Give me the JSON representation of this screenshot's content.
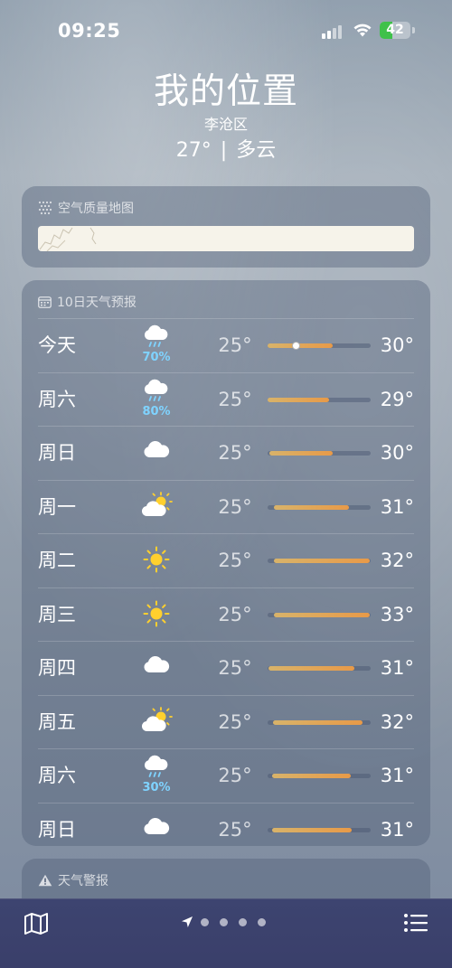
{
  "status": {
    "time": "09:25",
    "battery": "42",
    "battery_level": 42
  },
  "header": {
    "city": "我的位置",
    "district": "李沧区",
    "temp": "27°",
    "separator": "|",
    "condition": "多云"
  },
  "air_quality": {
    "title": "空气质量地图"
  },
  "forecast": {
    "title": "10日天气预报",
    "days": [
      {
        "day": "今天",
        "icon": "rain-icon",
        "pct": "70%",
        "lo": "25°",
        "hi": "30°",
        "bar_start": 0.0,
        "bar_end": 0.63,
        "current": 0.27
      },
      {
        "day": "周六",
        "icon": "rain-icon",
        "pct": "80%",
        "lo": "25°",
        "hi": "29°",
        "bar_start": 0.0,
        "bar_end": 0.6
      },
      {
        "day": "周日",
        "icon": "cloud-icon",
        "pct": "",
        "lo": "25°",
        "hi": "30°",
        "bar_start": 0.02,
        "bar_end": 0.63
      },
      {
        "day": "周一",
        "icon": "sun-cloud-icon",
        "pct": "",
        "lo": "25°",
        "hi": "31°",
        "bar_start": 0.06,
        "bar_end": 0.79
      },
      {
        "day": "周二",
        "icon": "sun-icon",
        "pct": "",
        "lo": "25°",
        "hi": "32°",
        "bar_start": 0.06,
        "bar_end": 0.99
      },
      {
        "day": "周三",
        "icon": "sun-icon",
        "pct": "",
        "lo": "25°",
        "hi": "33°",
        "bar_start": 0.06,
        "bar_end": 0.99
      },
      {
        "day": "周四",
        "icon": "cloud-icon",
        "pct": "",
        "lo": "25°",
        "hi": "31°",
        "bar_start": 0.01,
        "bar_end": 0.84
      },
      {
        "day": "周五",
        "icon": "sun-cloud-icon",
        "pct": "",
        "lo": "25°",
        "hi": "32°",
        "bar_start": 0.05,
        "bar_end": 0.92
      },
      {
        "day": "周六",
        "icon": "rain-icon",
        "pct": "30%",
        "lo": "25°",
        "hi": "31°",
        "bar_start": 0.04,
        "bar_end": 0.81
      },
      {
        "day": "周日",
        "icon": "cloud-icon",
        "pct": "",
        "lo": "25°",
        "hi": "31°",
        "bar_start": 0.04,
        "bar_end": 0.82
      }
    ]
  },
  "alert": {
    "title": "天气警报"
  },
  "toolbar": {
    "map_icon": "map-icon",
    "list_icon": "list-icon",
    "location_icon": "location-arrow-icon",
    "page_count": 4
  },
  "colors": {
    "bar_start": "#d8b36a",
    "bar_end": "#e89a48",
    "precip": "#7fd3ff",
    "battery": "#3fc14a",
    "toolbar": "#3d4470"
  }
}
